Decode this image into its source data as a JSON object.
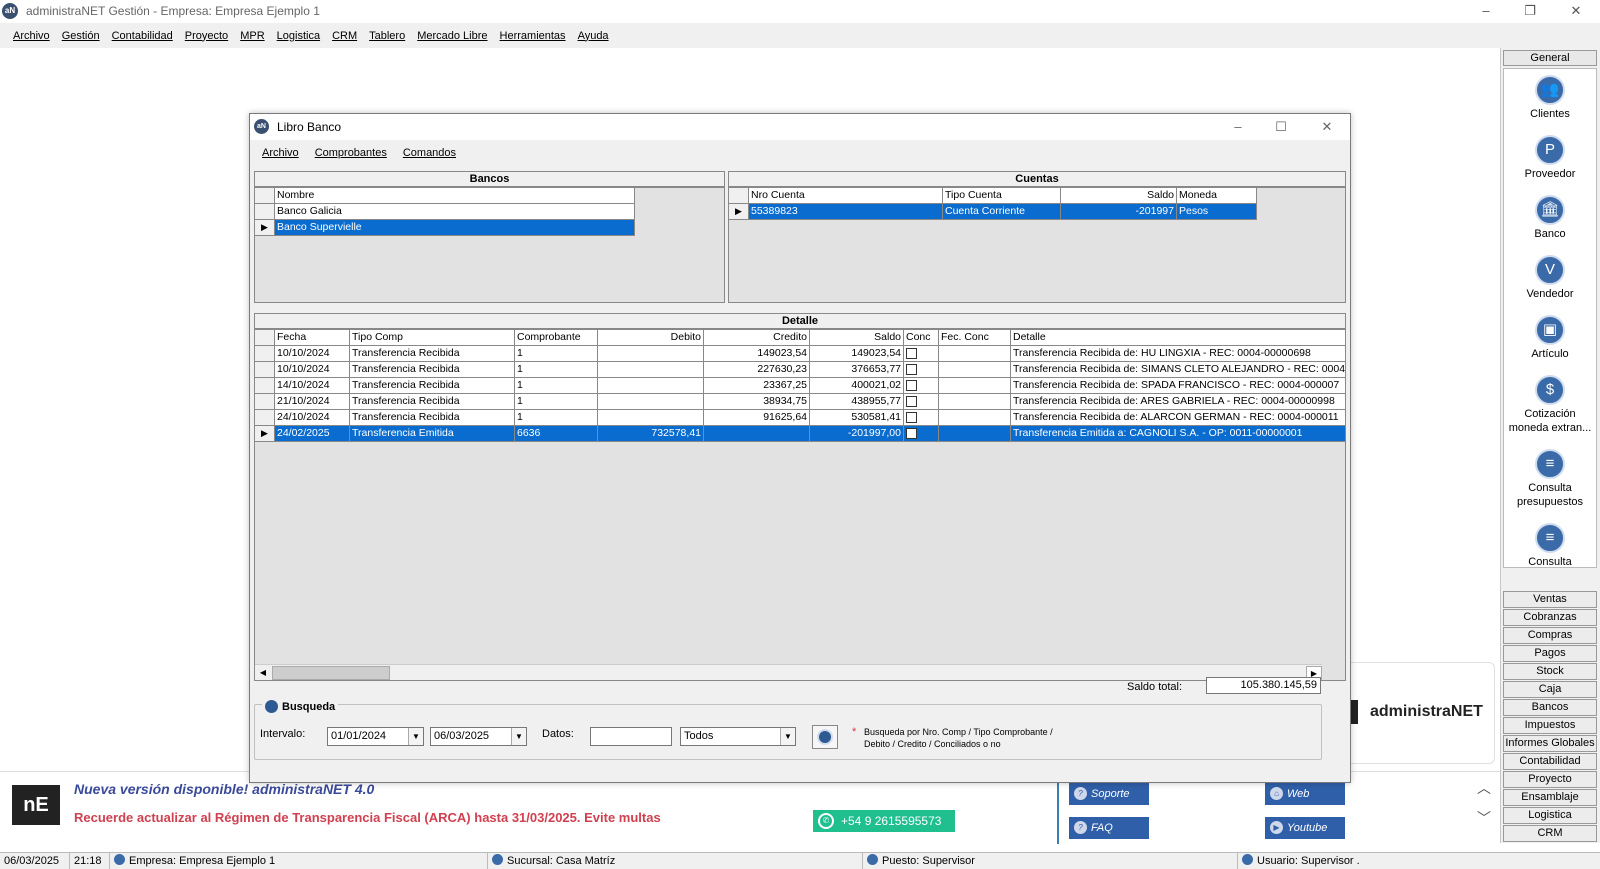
{
  "app": {
    "title": "administraNET Gestión - Empresa: Empresa Ejemplo 1",
    "logo_text": "aN"
  },
  "menu": [
    "Archivo",
    "Gestión",
    "Contabilidad",
    "Proyecto",
    "MPR",
    "Logistica",
    "CRM",
    "Tablero",
    "Mercado Libre",
    "Herramientas",
    "Ayuda"
  ],
  "right_panel": {
    "header": "General",
    "items": [
      {
        "label": "Clientes",
        "icon": "clients-icon"
      },
      {
        "label": "Proveedor",
        "icon": "supplier-icon"
      },
      {
        "label": "Banco",
        "icon": "bank-icon"
      },
      {
        "label": "Vendedor",
        "icon": "seller-icon"
      },
      {
        "label": "Artículo",
        "icon": "article-icon"
      },
      {
        "label": "Cotización moneda extran...",
        "icon": "currency-icon"
      },
      {
        "label": "Consulta presupuestos",
        "icon": "budget-icon"
      },
      {
        "label": "Consulta avanzada de a",
        "icon": "advanced-query-icon"
      }
    ],
    "categories": [
      "Ventas",
      "Cobranzas",
      "Compras",
      "Pagos",
      "Stock",
      "Caja",
      "Bancos",
      "Impuestos",
      "Informes Globales",
      "Contabilidad",
      "Proyecto",
      "Ensamblaje",
      "Logistica",
      "CRM"
    ]
  },
  "libro": {
    "title": "Libro Banco",
    "menu": [
      "Archivo",
      "Comprobantes",
      "Comandos"
    ],
    "bancos": {
      "header": "Bancos",
      "column": "Nombre",
      "rows": [
        "Banco Galicia",
        "Banco Supervielle"
      ]
    },
    "cuentas": {
      "header": "Cuentas",
      "columns": [
        "Nro Cuenta",
        "Tipo Cuenta",
        "Saldo",
        "Moneda"
      ],
      "rows": [
        [
          "55389823",
          "Cuenta Corriente",
          "-201997",
          "Pesos"
        ]
      ]
    },
    "detalle": {
      "header": "Detalle",
      "columns": [
        "Fecha",
        "Tipo Comp",
        "Comprobante",
        "Debito",
        "Credito",
        "Saldo",
        "Conc",
        "Fec. Conc",
        "Detalle"
      ],
      "rows": [
        [
          "10/10/2024",
          "Transferencia Recibida",
          "1",
          "",
          "149023,54",
          "149023,54",
          "",
          "",
          "Transferencia Recibida de: HU LINGXIA - REC: 0004-00000698"
        ],
        [
          "10/10/2024",
          "Transferencia Recibida",
          "1",
          "",
          "227630,23",
          "376653,77",
          "",
          "",
          "Transferencia Recibida de: SIMANS CLETO ALEJANDRO - REC: 0004"
        ],
        [
          "14/10/2024",
          "Transferencia Recibida",
          "1",
          "",
          "23367,25",
          "400021,02",
          "",
          "",
          "Transferencia Recibida de: SPADA FRANCISCO - REC: 0004-000007"
        ],
        [
          "21/10/2024",
          "Transferencia Recibida",
          "1",
          "",
          "38934,75",
          "438955,77",
          "",
          "",
          "Transferencia Recibida de: ARES GABRIELA - REC: 0004-00000998"
        ],
        [
          "24/10/2024",
          "Transferencia Recibida",
          "1",
          "",
          "91625,64",
          "530581,41",
          "",
          "",
          "Transferencia Recibida de: ALARCON GERMAN - REC: 0004-000011"
        ],
        [
          "24/02/2025",
          "Transferencia Emitida",
          "6636",
          "732578,41",
          "",
          "-201997,00",
          "",
          "",
          "Transferencia Emitida a: CAGNOLI S.A. - OP: 0011-00000001"
        ]
      ]
    },
    "saldo_label": "Saldo total:",
    "saldo_value": "105.380.145,59",
    "busqueda": {
      "title": "Busqueda",
      "intervalo_label": "Intervalo:",
      "desde": "01/01/2024",
      "hasta": "06/03/2025",
      "datos_label": "Datos:",
      "datos_value": "",
      "filtro": "Todos",
      "hint_bullet": "*",
      "hint_line1": "Busqueda por Nro. Comp / Tipo Comprobante /",
      "hint_line2": "Debito / Credito / Conciliados o no"
    }
  },
  "brand": {
    "text": "administraNET"
  },
  "banner": {
    "logo_text": "nE",
    "title": "Nueva versión disponible! administraNET 4.0",
    "warning": "Recuerde actualizar al Régimen de Transparencia Fiscal (ARCA) hasta 31/03/2025. Evite multas",
    "whatsapp": "+54 9 2615595573",
    "links": {
      "soporte": "Soporte",
      "faq": "FAQ",
      "web": "Web",
      "youtube": "Youtube"
    }
  },
  "status": {
    "date": "06/03/2025",
    "time": "21:18",
    "empresa": "Empresa: Empresa Ejemplo 1",
    "sucursal": "Sucursal: Casa Matríz",
    "puesto": "Puesto: Supervisor",
    "usuario": "Usuario: Supervisor ."
  }
}
